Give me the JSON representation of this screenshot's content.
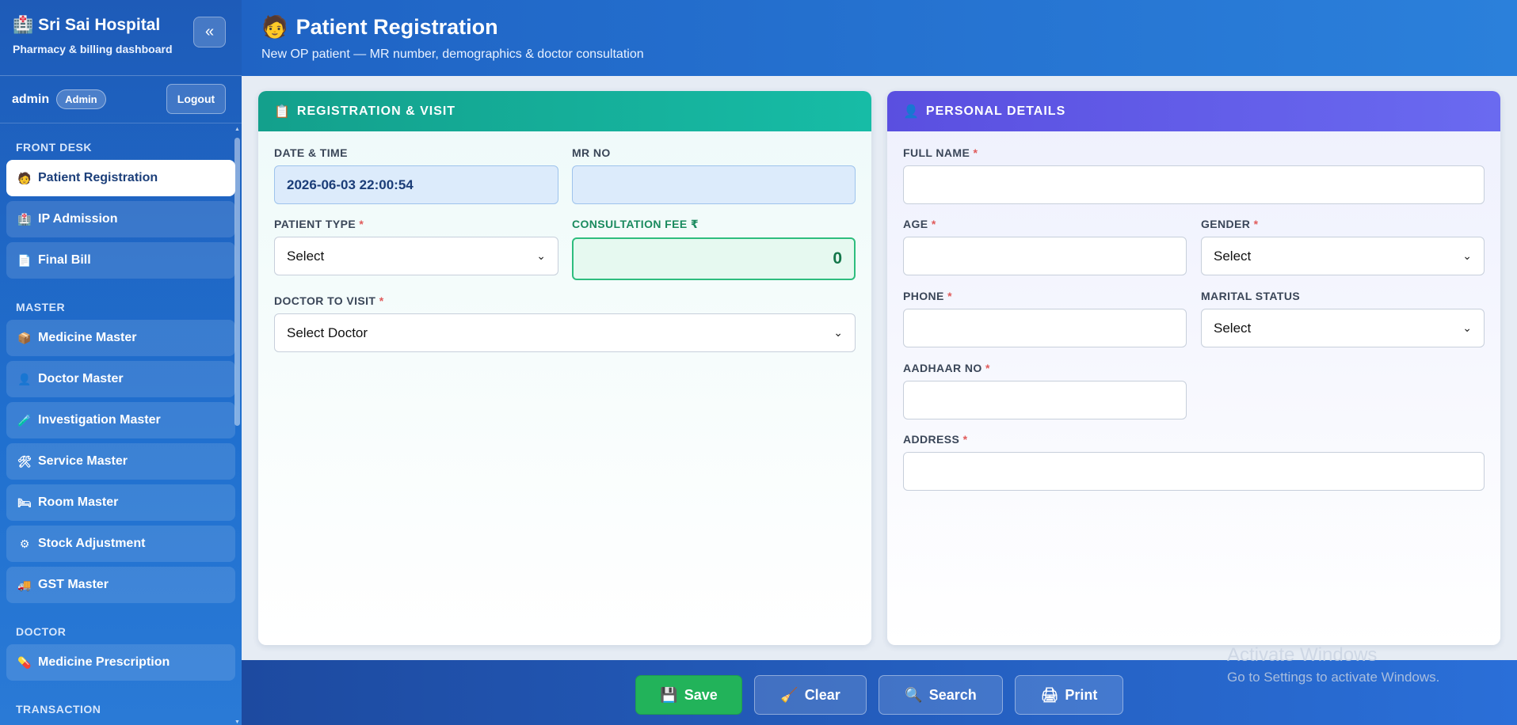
{
  "sidebar": {
    "brand_icon": "🏥",
    "brand_title": "Sri Sai Hospital",
    "brand_sub": "Pharmacy & billing dashboard",
    "collapse_label": "«",
    "user": {
      "name": "admin",
      "role": "Admin",
      "logout": "Logout"
    },
    "sections": [
      {
        "label": "FRONT DESK",
        "items": [
          {
            "icon": "🧑",
            "label": "Patient Registration",
            "active": true
          },
          {
            "icon": "🏥",
            "label": "IP Admission"
          },
          {
            "icon": "📄",
            "label": "Final Bill"
          }
        ]
      },
      {
        "label": "MASTER",
        "items": [
          {
            "icon": "📦",
            "label": "Medicine Master"
          },
          {
            "icon": "👤",
            "label": "Doctor Master"
          },
          {
            "icon": "🧪",
            "label": "Investigation Master"
          },
          {
            "icon": "🛠",
            "label": "Service Master"
          },
          {
            "icon": "🛏",
            "label": "Room Master"
          },
          {
            "icon": "⚙",
            "label": "Stock Adjustment"
          },
          {
            "icon": "🚚",
            "label": "GST Master"
          }
        ]
      },
      {
        "label": "DOCTOR",
        "items": [
          {
            "icon": "💊",
            "label": "Medicine Prescription"
          }
        ]
      },
      {
        "label": "TRANSACTION",
        "items": []
      }
    ]
  },
  "header": {
    "icon": "🧑",
    "title": "Patient Registration",
    "subtitle": "New OP patient — MR number, demographics & doctor consultation"
  },
  "registration": {
    "icon": "📋",
    "title": "REGISTRATION & VISIT",
    "date_label": "DATE & TIME",
    "date_value": "2026-06-03 22:00:54",
    "mr_label": "MR NO",
    "mr_value": "",
    "patient_type_label": "PATIENT TYPE",
    "patient_type_value": "Select",
    "fee_label": "CONSULTATION FEE ₹",
    "fee_value": "0",
    "doctor_label": "DOCTOR TO VISIT",
    "doctor_value": "Select Doctor"
  },
  "personal": {
    "icon": "👤",
    "title": "PERSONAL DETAILS",
    "full_name_label": "FULL NAME",
    "age_label": "AGE",
    "gender_label": "GENDER",
    "gender_value": "Select",
    "phone_label": "PHONE",
    "marital_label": "MARITAL STATUS",
    "marital_value": "Select",
    "aadhaar_label": "AADHAAR NO",
    "address_label": "ADDRESS"
  },
  "required_mark": "*",
  "footer": {
    "save": "Save",
    "save_icon": "💾",
    "clear": "Clear",
    "clear_icon": "🧹",
    "search": "Search",
    "search_icon": "🔍",
    "print": "Print",
    "print_icon": "🖨"
  },
  "watermark": {
    "title": "Activate Windows",
    "subtitle": "Go to Settings to activate Windows."
  },
  "colors": {
    "accent": "#2070cf",
    "registration_header": "#17bca6",
    "personal_header": "#5a4fe0",
    "save_button": "#22b35a",
    "required": "#e05b5b"
  }
}
